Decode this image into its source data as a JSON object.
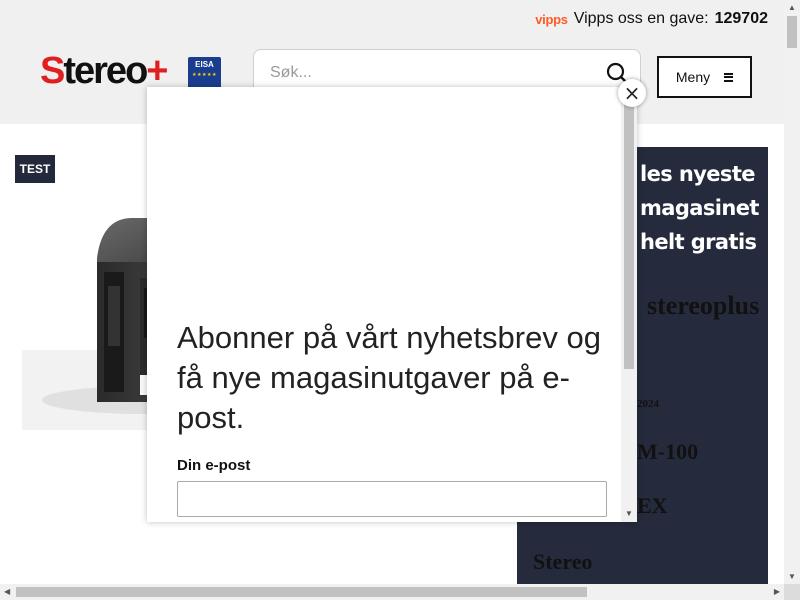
{
  "header": {
    "vipps_logo": "vipps",
    "vipps_text": "Vipps oss en gave:",
    "vipps_code": "129702",
    "logo_s": "S",
    "logo_rest": "tereo",
    "logo_plus": "+",
    "eisa_label": "EISA",
    "search_placeholder": "Søk...",
    "menu_label": "Meny",
    "colors": {
      "brand_red": "#e02020",
      "vipps_orange": "#ff5b24",
      "eisa_blue": "#1a3d8f"
    }
  },
  "article": {
    "badge": "TEST",
    "badge_color": "#23293a"
  },
  "promo": {
    "heading": "les nyeste magasinet helt gratis",
    "brand": "stereoplus",
    "date": "2024",
    "model1": "M-100",
    "model2": "EX",
    "word": "Stereo",
    "background": "#252b3d"
  },
  "modal": {
    "title": "Abonner på vårt nyhetsbrev og få nye magasinutgaver på e-post.",
    "email_label": "Din e-post",
    "email_value": "",
    "close_icon": "close-icon"
  }
}
